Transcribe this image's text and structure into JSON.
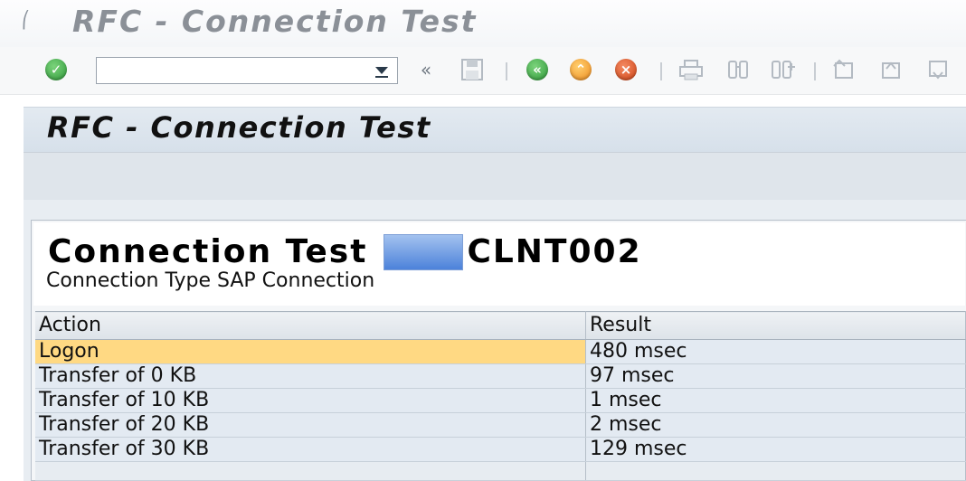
{
  "window": {
    "title": "RFC - Connection Test"
  },
  "toolbar": {
    "command_value": "",
    "buttons": [
      {
        "name": "enter-icon",
        "symbol": "check"
      },
      {
        "name": "save-icon",
        "symbol": "floppy"
      },
      {
        "name": "back-icon",
        "symbol": "green-back"
      },
      {
        "name": "exit-icon",
        "symbol": "orange-up"
      },
      {
        "name": "cancel-icon",
        "symbol": "red-x"
      },
      {
        "name": "print-icon",
        "symbol": "printer"
      },
      {
        "name": "find-icon",
        "symbol": "binoculars"
      },
      {
        "name": "find-next-icon",
        "symbol": "binoculars-plus"
      },
      {
        "name": "first-page-icon",
        "symbol": "page-first"
      },
      {
        "name": "previous-page-icon",
        "symbol": "page-up"
      },
      {
        "name": "next-page-icon",
        "symbol": "page-down"
      }
    ]
  },
  "screen": {
    "title": "RFC - Connection Test"
  },
  "result": {
    "heading_prefix": "Connection Test",
    "heading_suffix": "CLNT002",
    "subheading": "Connection Type SAP Connection"
  },
  "table": {
    "columns": [
      "Action",
      "Result"
    ],
    "rows": [
      {
        "action": "Logon",
        "result": "480  msec",
        "selected": true
      },
      {
        "action": "Transfer of 0 KB",
        "result": "97  msec",
        "selected": false
      },
      {
        "action": "Transfer of 10 KB",
        "result": "1  msec",
        "selected": false
      },
      {
        "action": "Transfer of 20 KB",
        "result": "2  msec",
        "selected": false
      },
      {
        "action": "Transfer of 30 KB",
        "result": "129  msec",
        "selected": false
      }
    ]
  },
  "colors": {
    "selected_row": "#ffd983",
    "grid_row": "#e3eaf2",
    "header_band": "#d6e0ea"
  }
}
